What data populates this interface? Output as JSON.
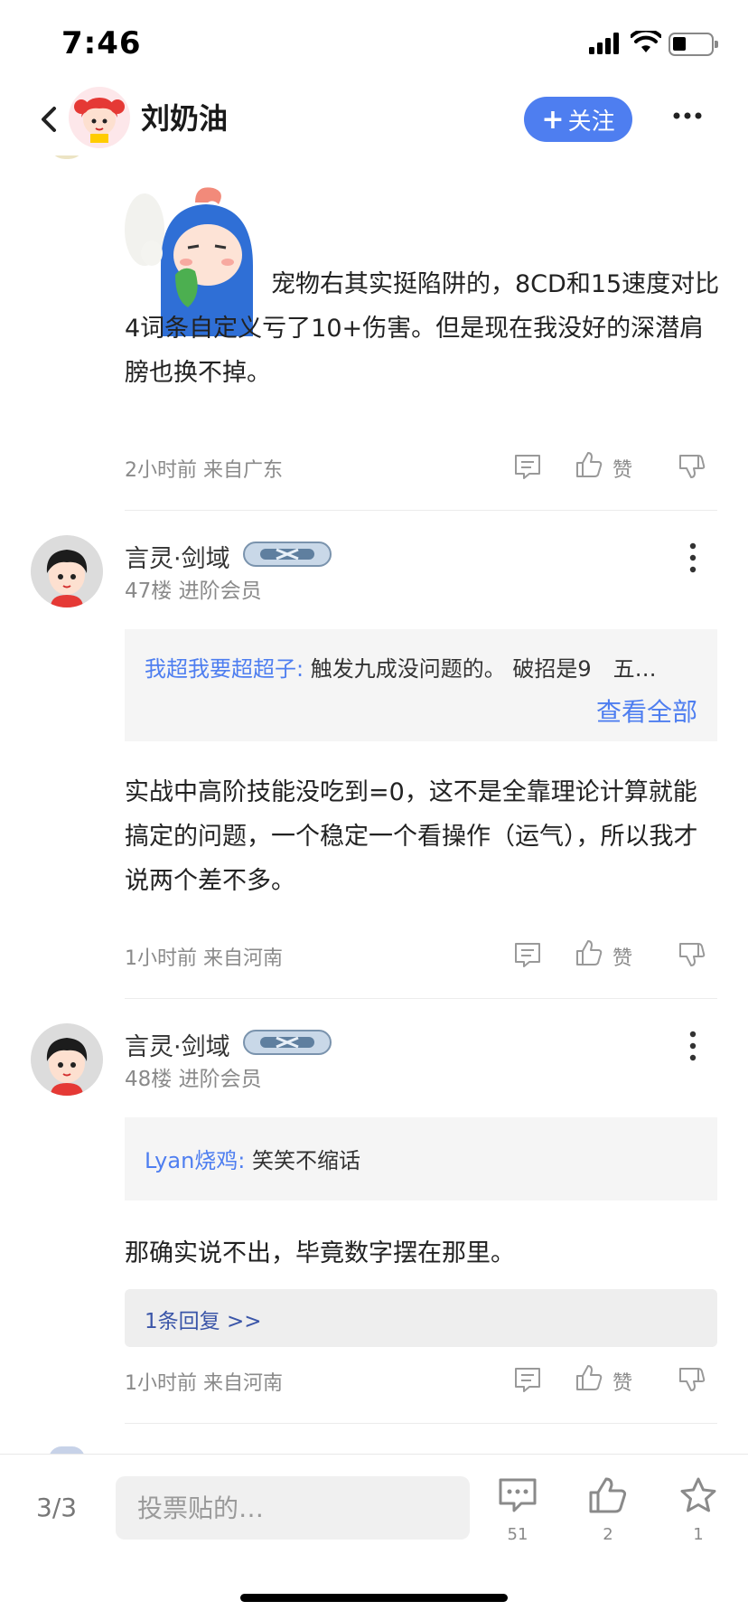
{
  "status_bar": {
    "time": "7:46"
  },
  "header": {
    "author_name": "刘奶油",
    "follow_label": "关注",
    "follow_plus": "+"
  },
  "first_post": {
    "text": "宠物右其实挺陷阱的，8CD和15速度对比4词条自定义亏了10+伤害。但是现在我没好的深潜肩膀也换不掉。",
    "meta": "2小时前 来自广东",
    "like_label": "赞"
  },
  "floors": [
    {
      "name": "言灵·剑域",
      "sub": "47楼 进阶会员",
      "quote_user": "我超我要超超子:",
      "quote_text": "触发九成没问题的。 破招是9　五…",
      "quote_more": "查看全部",
      "text": "实战中高阶技能没吃到=0，这不是全靠理论计算就能搞定的问题，一个稳定一个看操作（运气），所以我才说两个差不多。",
      "meta": "1小时前 来自河南",
      "like_label": "赞"
    },
    {
      "name": "言灵·剑域",
      "sub": "48楼 进阶会员",
      "quote_user": "Lyan烧鸡:",
      "quote_text": "笑笑不缩话",
      "text": "那确实说不出，毕竟数字摆在那里。",
      "reply_link": "1条回复 >>",
      "meta": "1小时前 来自河南",
      "like_label": "赞"
    }
  ],
  "bottom_bar": {
    "page_indicator": "3/3",
    "input_placeholder": "投票贴的…",
    "comment_count": "51",
    "like_count": "2",
    "star_count": "1"
  },
  "colors": {
    "accent": "#4e7ef0",
    "reply_link": "#3a55a8",
    "meta_gray": "#8a8a8a",
    "quote_bg": "#f5f5f5"
  }
}
